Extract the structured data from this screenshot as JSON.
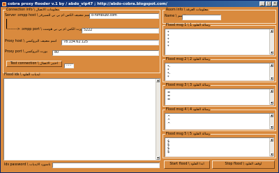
{
  "window": {
    "title": "cobra proxy flooder v.1 by / abdo_vip47 ; http://abdo-cobra.blogspot.com/",
    "minimize": "_",
    "maximize": "□",
    "close": "×"
  },
  "connection": {
    "legend": "Connection info \\ معلومات الاتصال",
    "server_label": "Server :xmpp host \\ اسم مضيف الكس ام بي بي للسيرفر",
    "server_value": "o-nimbuzz.com",
    "port_label": "---------> :xmpp port \\ بورت الكس ام بي بي هوست",
    "port_value": "5222",
    "proxy_host_label": "Proxy host \\ اسم مضيف البروكسي",
    "proxy_host_value": "78.134.62.125",
    "proxy_port_label": "Proxy port \\ بورت البروكسي",
    "proxy_port_value": "80",
    "test_button": "Test connection \\ اختبر الاتصال",
    "test_result": "....."
  },
  "flood_ids": {
    "legend": "Flood ids \\ ايديات الفلود",
    "content": ""
  },
  "ids_password": {
    "label": "Ids password \\ باسورد الايديات",
    "value": ""
  },
  "room": {
    "legend": "Room info \\ معلومات الغرفة",
    "name_label": "Name \\ الاسم",
    "name_value": ""
  },
  "messages": [
    {
      "label": "Flood msg 1 \\ رسالة الفلود 1",
      "content": "*\n*\n*\n*\n*"
    },
    {
      "label": "Flood msg 2 \\ رسالة الفلود 2",
      "content": "*-\n*\n*-\n*"
    },
    {
      "label": "Flood msg 3 \\ رسالة الفلود 3",
      "content": "=\n=\n="
    },
    {
      "label": "Flood msg 4 \\ رسالة الفلود 4",
      "content": "^\n^\n^"
    },
    {
      "label": "Flood msg 5 \\ رسالة الفلود 5",
      "content": "$\n$\n$\n$"
    }
  ],
  "actions": {
    "start": "Start flood \\ ابدا الفلود",
    "stop": "Stop flood \\ اوقف الفلود"
  }
}
